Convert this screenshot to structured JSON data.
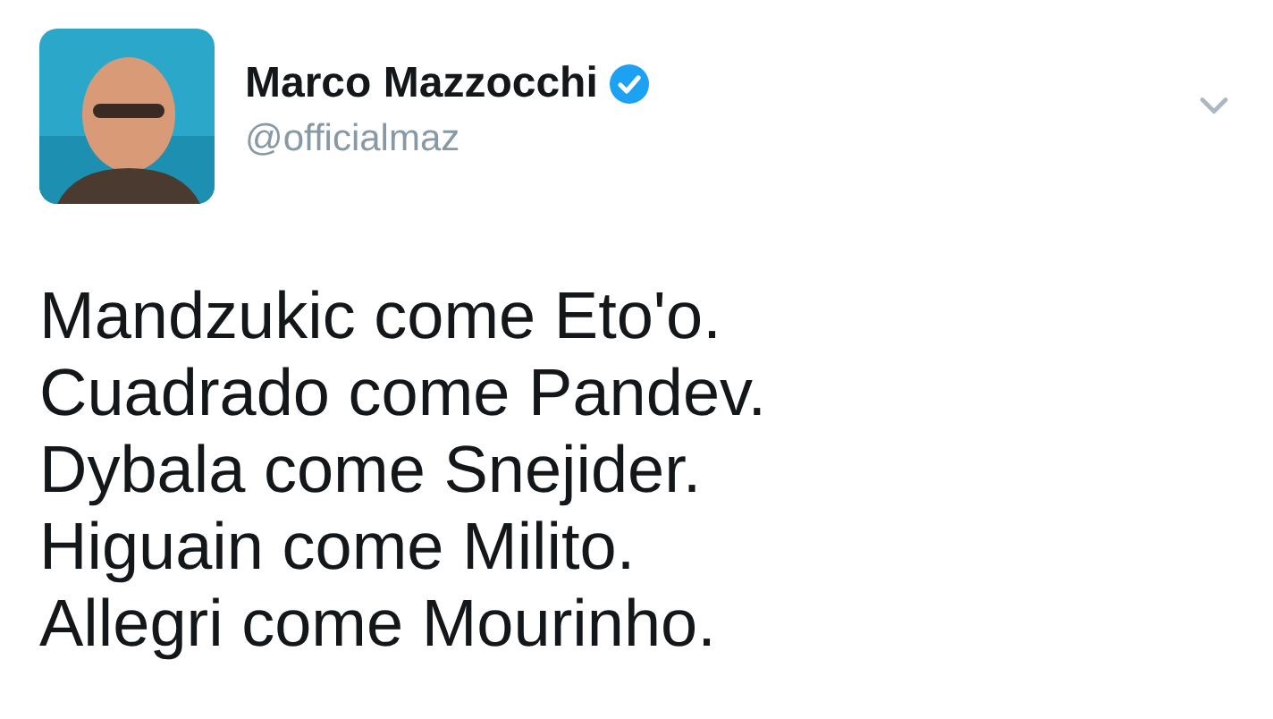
{
  "author": {
    "name": "Marco Mazzocchi",
    "verified": true,
    "handle": "@officialmaz"
  },
  "tweet": {
    "lines": [
      "Mandzukic come Eto'o.",
      "Cuadrado come Pandev.",
      "Dybala come Snejider.",
      "Higuain come Milito.",
      "Allegri come Mourinho."
    ]
  }
}
